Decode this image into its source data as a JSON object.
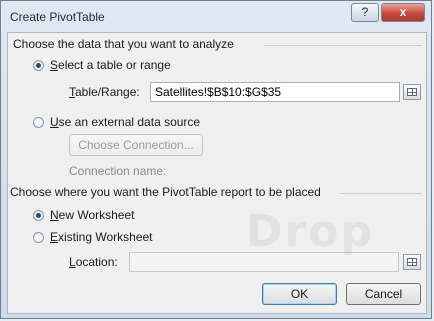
{
  "window": {
    "title": "Create PivotTable",
    "help_label": "?",
    "close_label": "x"
  },
  "data_section": {
    "heading": "Choose the data that you want to analyze",
    "option_table": {
      "label_key": "S",
      "label_rest": "elect a table or range",
      "checked": true
    },
    "table_range": {
      "label_key": "T",
      "label_rest": "able/Range:",
      "value": "Satellites!$B$10:$G$35"
    },
    "option_external": {
      "label_key": "U",
      "label_rest": "se an external data source",
      "checked": false
    },
    "choose_connection_label": "Choose Connection...",
    "connection_name_label": "Connection name:"
  },
  "placement_section": {
    "heading": "Choose where you want the PivotTable report to be placed",
    "option_new": {
      "label_key": "N",
      "label_rest": "ew Worksheet",
      "checked": true
    },
    "option_existing": {
      "label_key": "E",
      "label_rest": "xisting Worksheet",
      "checked": false
    },
    "location": {
      "label_key": "L",
      "label_rest": "ocation:",
      "value": ""
    }
  },
  "buttons": {
    "ok": "OK",
    "cancel": "Cancel"
  },
  "watermark": "Drop"
}
